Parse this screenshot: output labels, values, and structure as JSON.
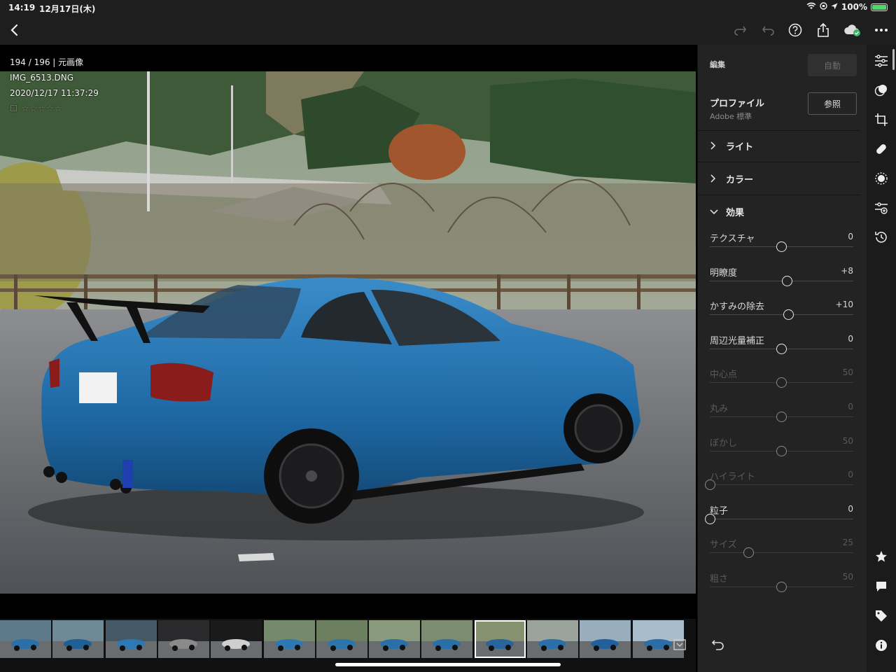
{
  "status_bar": {
    "time": "14:19",
    "date": "12月17日(木)",
    "battery": "100%"
  },
  "photo_info": {
    "counter": "194 / 196 | 元画像",
    "filename": "IMG_6513.DNG",
    "datetime": "2020/12/17 11:37:29",
    "rating_stars": "☐ ☆☆☆☆☆"
  },
  "panel": {
    "title": "編集",
    "auto_label": "自動",
    "profile_label": "プロファイル",
    "profile_value": "Adobe 標準",
    "browse_label": "参照",
    "sections": {
      "light": "ライト",
      "color": "カラー",
      "effects": "効果"
    },
    "sliders": [
      {
        "label": "テクスチャ",
        "value": "0",
        "position": 0.5,
        "enabled": true
      },
      {
        "label": "明瞭度",
        "value": "+8",
        "position": 0.54,
        "enabled": true
      },
      {
        "label": "かすみの除去",
        "value": "+10",
        "position": 0.55,
        "enabled": true
      },
      {
        "label": "周辺光量補正",
        "value": "0",
        "position": 0.5,
        "enabled": true
      },
      {
        "label": "中心点",
        "value": "50",
        "position": 0.5,
        "enabled": false
      },
      {
        "label": "丸み",
        "value": "0",
        "position": 0.5,
        "enabled": false
      },
      {
        "label": "ぼかし",
        "value": "50",
        "position": 0.5,
        "enabled": false
      },
      {
        "label": "ハイライト",
        "value": "0",
        "position": 0.0,
        "enabled": false
      },
      {
        "label": "粒子",
        "value": "0",
        "position": 0.0,
        "enabled": true
      },
      {
        "label": "サイズ",
        "value": "25",
        "position": 0.27,
        "enabled": false
      },
      {
        "label": "粗さ",
        "value": "50",
        "position": 0.5,
        "enabled": false
      }
    ]
  },
  "toolbar_icons": [
    "back-icon",
    "redo-icon",
    "undo-icon",
    "help-icon",
    "share-icon",
    "cloud-sync-icon",
    "more-icon"
  ],
  "rail_icons": [
    "edit-sliders-icon",
    "presets-icon",
    "crop-icon",
    "healing-icon",
    "masking-icon",
    "versions-icon",
    "history-icon",
    "star-icon",
    "comment-icon",
    "tag-icon",
    "info-icon"
  ],
  "filmstrip": {
    "selected_index": 9
  },
  "colors": {
    "accent_green": "#4cd964",
    "panel_bg": "#232323",
    "car_blue": "#2a6fa8"
  }
}
